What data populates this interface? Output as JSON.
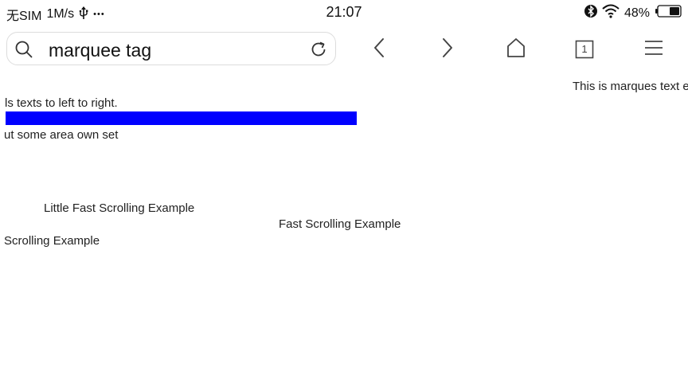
{
  "status_bar": {
    "carrier": "无SIM",
    "speed": "1M/s",
    "dots": "•••",
    "time": "21:07",
    "battery_percent": "48%",
    "battery_level": 0.48
  },
  "toolbar": {
    "address_text": "marquee tag",
    "tab_count": "1"
  },
  "page": {
    "marquee_right_text": "This is marques text e",
    "marquee_left_right_text": "ls texts to left to right.",
    "marquee_area_text": "ut some area own set",
    "little_fast_text": "Little Fast Scrolling Example",
    "fast_text": "Fast Scrolling Example",
    "scrolling_text": "Scrolling Example",
    "bar_color": "#0000ff"
  }
}
